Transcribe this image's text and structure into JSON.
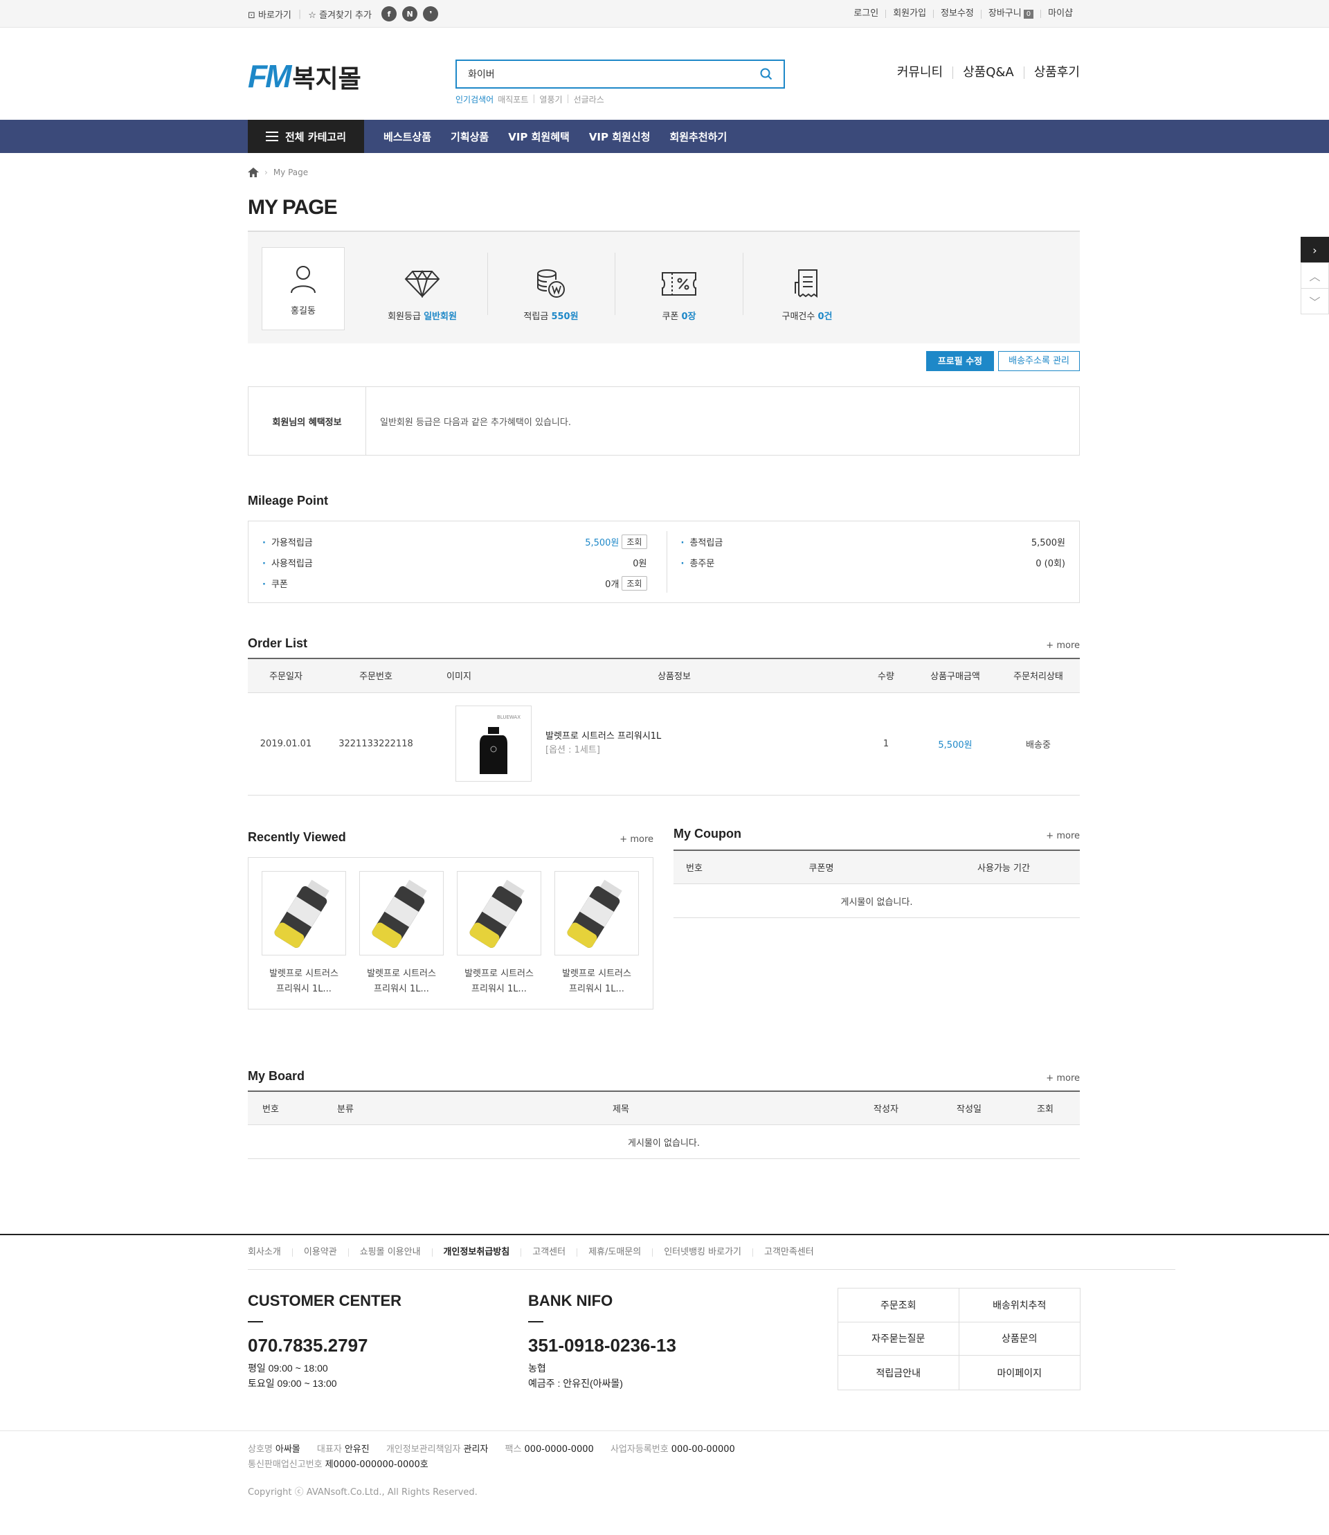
{
  "topbar": {
    "left": [
      "바로가기",
      "즐겨찾기 추가"
    ],
    "sns": [
      "f",
      "N",
      "❜"
    ],
    "right": [
      "로그인",
      "회원가입",
      "정보수정",
      "장바구니",
      "마이샵"
    ],
    "cart_count": "0"
  },
  "header": {
    "logo_fm": "FM",
    "logo_kr": "복지몰",
    "search_value": "화이버",
    "keywords_label": "인기검색어",
    "keywords": [
      "매직포트",
      "열풍기",
      "선글라스"
    ],
    "links": [
      "커뮤니티",
      "상품Q&A",
      "상품후기"
    ]
  },
  "gnb": {
    "all_category": "전체 카테고리",
    "menu": [
      "베스트상품",
      "기획상품",
      "VIP 회원혜택",
      "VIP 회원신청",
      "회원추천하기"
    ]
  },
  "breadcrumb": {
    "current": "My Page"
  },
  "page_title": "MY PAGE",
  "summary": {
    "user_name": "홍길동",
    "grade_label": "회원등급",
    "grade_value": "일반회원",
    "points_label": "적립금",
    "points_value": "550원",
    "coupon_label": "쿠폰",
    "coupon_value": "0장",
    "orders_label": "구매건수",
    "orders_value": "0건"
  },
  "buttons": {
    "edit_profile": "프로필 수정",
    "address_book": "배송주소록 관리"
  },
  "benefit": {
    "label": "회원님의 혜택정보",
    "text": "일반회원 등급은 다음과 같은 추가혜택이 있습니다."
  },
  "mileage": {
    "title": "Mileage Point",
    "available_label": "가용적립금",
    "available_value": "5,500원",
    "used_label": "사용적립금",
    "used_value": "0원",
    "coupon_label": "쿠폰",
    "coupon_value": "0개",
    "view": "조회",
    "total_label": "총적립금",
    "total_value": "5,500원",
    "orders_label": "총주문",
    "orders_value": "0 (0회)"
  },
  "order_list": {
    "title": "Order List",
    "more": "+ more",
    "headers": [
      "주문일자",
      "주문번호",
      "이미지",
      "상품정보",
      "수량",
      "상품구매금액",
      "주문처리상태"
    ],
    "rows": [
      {
        "date": "2019.01.01",
        "number": "3221133222118",
        "name": "발렛프로 시트러스 프리워시1L",
        "option": "[옵션 : 1세트]",
        "qty": "1",
        "price": "5,500원",
        "status": "배송중",
        "brand": "BLUEWAX"
      }
    ]
  },
  "recent": {
    "title": "Recently Viewed",
    "more": "+ more",
    "items": [
      {
        "line1": "발렛프로 시트러스",
        "line2": "프리워시 1L..."
      },
      {
        "line1": "발렛프로 시트러스",
        "line2": "프리워시 1L..."
      },
      {
        "line1": "발렛프로 시트러스",
        "line2": "프리워시 1L..."
      },
      {
        "line1": "발렛프로 시트러스",
        "line2": "프리워시 1L..."
      }
    ]
  },
  "coupon": {
    "title": "My Coupon",
    "more": "+ more",
    "headers": [
      "번호",
      "쿠폰명",
      "사용가능 기간"
    ],
    "empty": "게시물이 없습니다."
  },
  "board": {
    "title": "My Board",
    "more": "+ more",
    "headers": [
      "번호",
      "분류",
      "제목",
      "작성자",
      "작성일",
      "조회"
    ],
    "empty": "게시물이 없습니다."
  },
  "footer": {
    "nav": [
      "회사소개",
      "이용약관",
      "쇼핑몰 이용안내",
      "개인정보취급방침",
      "고객센터",
      "제휴/도매문의",
      "인터넷뱅킹 바로가기",
      "고객만족센터"
    ],
    "cc_title": "CUSTOMER CENTER",
    "cc_phone": "070.7835.2797",
    "cc_hours1": "평일 09:00 ~ 18:00",
    "cc_hours2": "토요일 09:00 ~ 13:00",
    "bank_title": "BANK NIFO",
    "bank_number": "351-0918-0236-13",
    "bank_name": "농협",
    "bank_holder": "예금주 : 안유진(아싸몰)",
    "quick": [
      "주문조회",
      "배송위치추적",
      "자주묻는질문",
      "상품문의",
      "적립금안내",
      "마이페이지"
    ],
    "company_label": "상호명",
    "company": "아싸몰",
    "ceo_label": "대표자",
    "ceo": "안유진",
    "privacy_label": "개인정보관리책임자",
    "privacy": "관리자",
    "fax_label": "팩스",
    "fax": "000-0000-0000",
    "biz_label": "사업자등록번호",
    "biz": "000-00-00000",
    "mail_label": "통신판매업신고번호",
    "mail": "제0000-000000-0000호",
    "copyright": "Copyright ⓒ AVANsoft.Co.Ltd., All Rights Reserved."
  },
  "colors": {
    "accent": "#1e88c8",
    "nav": "#3b4a7a"
  }
}
